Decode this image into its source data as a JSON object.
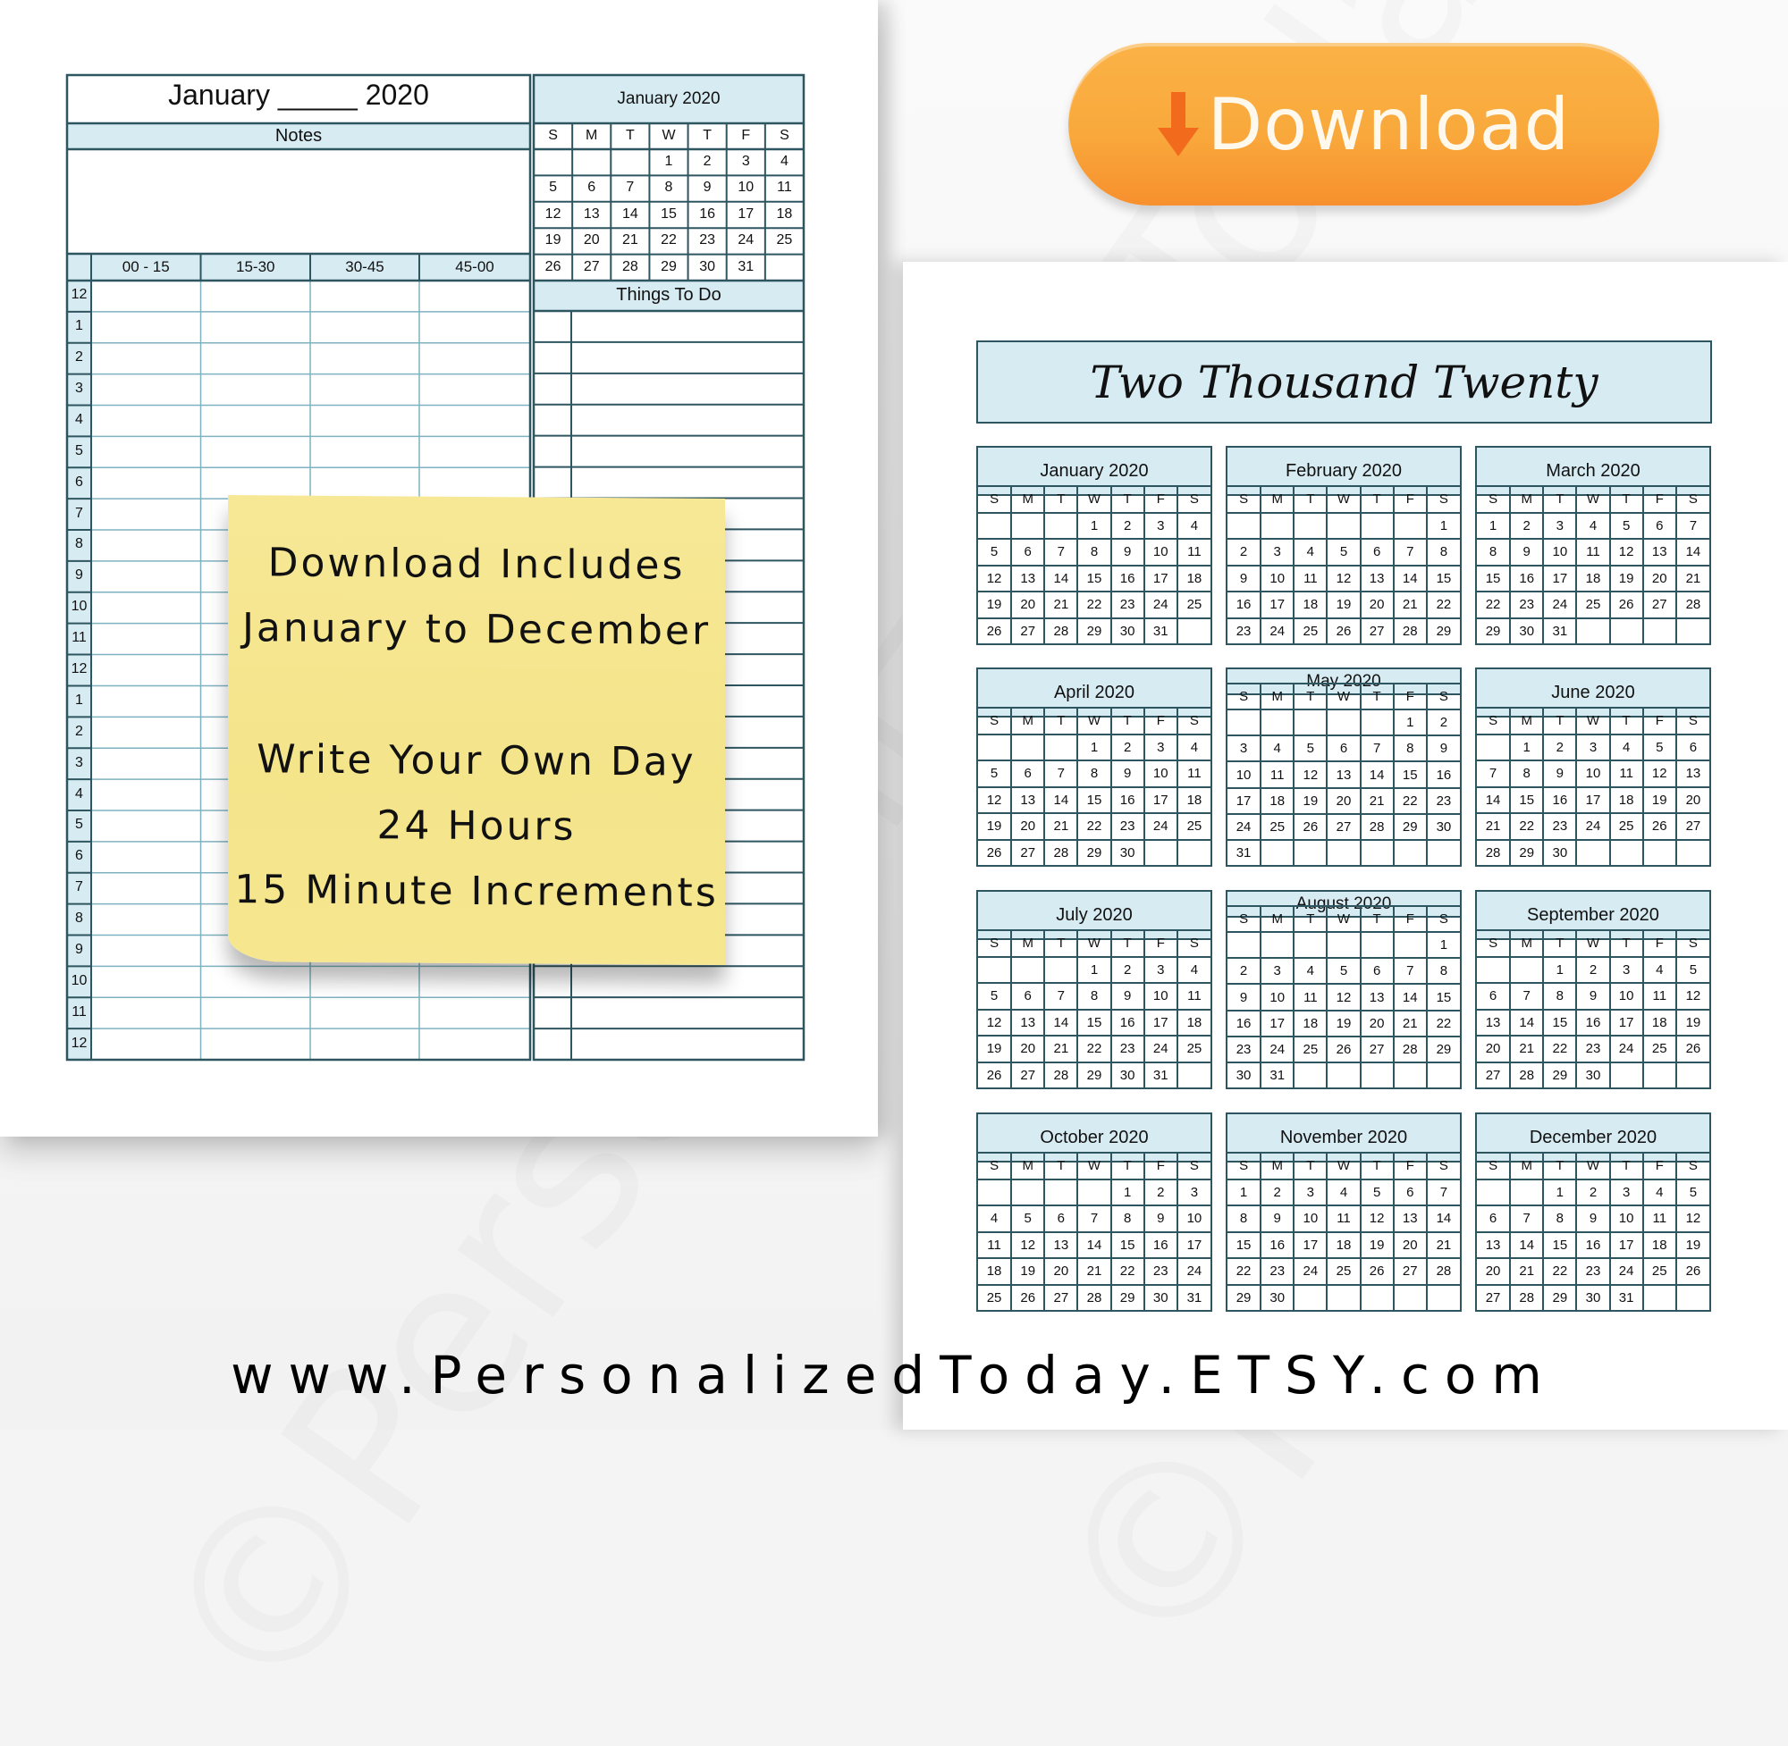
{
  "left_page": {
    "title": "January _____ 2020",
    "notes_label": "Notes",
    "column_headers": [
      "00 - 15",
      "15-30",
      "30-45",
      "45-00"
    ],
    "hours": [
      "12",
      "1",
      "2",
      "3",
      "4",
      "5",
      "6",
      "7",
      "8",
      "9",
      "10",
      "11",
      "12",
      "1",
      "2",
      "3",
      "4",
      "5",
      "6",
      "7",
      "8",
      "9",
      "10",
      "11",
      "12"
    ],
    "mini_calendar": {
      "title": "January 2020",
      "weekdays": [
        "S",
        "M",
        "T",
        "W",
        "T",
        "F",
        "S"
      ],
      "weeks": [
        [
          "",
          "",
          "",
          "1",
          "2",
          "3",
          "4"
        ],
        [
          "5",
          "6",
          "7",
          "8",
          "9",
          "10",
          "11"
        ],
        [
          "12",
          "13",
          "14",
          "15",
          "16",
          "17",
          "18"
        ],
        [
          "19",
          "20",
          "21",
          "22",
          "23",
          "24",
          "25"
        ],
        [
          "26",
          "27",
          "28",
          "29",
          "30",
          "31",
          ""
        ]
      ]
    },
    "todo_label": "Things To Do"
  },
  "sticky_note": {
    "lines": [
      "Download Includes",
      "January to December",
      "",
      "Write Your Own Day",
      "24 Hours",
      "15 Minute Increments"
    ]
  },
  "download_button": {
    "label": "Download",
    "icon": "arrow-down-icon",
    "arrow_color": "#f26b1d",
    "button_color": "#f9a93c"
  },
  "right_page": {
    "title": "Two Thousand Twenty",
    "weekdays": [
      "S",
      "M",
      "T",
      "W",
      "T",
      "F",
      "S"
    ],
    "months": [
      {
        "name": "January 2020",
        "weeks": [
          [
            "",
            "",
            "",
            "1",
            "2",
            "3",
            "4"
          ],
          [
            "5",
            "6",
            "7",
            "8",
            "9",
            "10",
            "11"
          ],
          [
            "12",
            "13",
            "14",
            "15",
            "16",
            "17",
            "18"
          ],
          [
            "19",
            "20",
            "21",
            "22",
            "23",
            "24",
            "25"
          ],
          [
            "26",
            "27",
            "28",
            "29",
            "30",
            "31",
            ""
          ]
        ]
      },
      {
        "name": "February 2020",
        "weeks": [
          [
            "",
            "",
            "",
            "",
            "",
            "",
            "1"
          ],
          [
            "2",
            "3",
            "4",
            "5",
            "6",
            "7",
            "8"
          ],
          [
            "9",
            "10",
            "11",
            "12",
            "13",
            "14",
            "15"
          ],
          [
            "16",
            "17",
            "18",
            "19",
            "20",
            "21",
            "22"
          ],
          [
            "23",
            "24",
            "25",
            "26",
            "27",
            "28",
            "29"
          ]
        ]
      },
      {
        "name": "March 2020",
        "weeks": [
          [
            "1",
            "2",
            "3",
            "4",
            "5",
            "6",
            "7"
          ],
          [
            "8",
            "9",
            "10",
            "11",
            "12",
            "13",
            "14"
          ],
          [
            "15",
            "16",
            "17",
            "18",
            "19",
            "20",
            "21"
          ],
          [
            "22",
            "23",
            "24",
            "25",
            "26",
            "27",
            "28"
          ],
          [
            "29",
            "30",
            "31",
            "",
            "",
            "",
            ""
          ]
        ]
      },
      {
        "name": "April 2020",
        "weeks": [
          [
            "",
            "",
            "",
            "1",
            "2",
            "3",
            "4"
          ],
          [
            "5",
            "6",
            "7",
            "8",
            "9",
            "10",
            "11"
          ],
          [
            "12",
            "13",
            "14",
            "15",
            "16",
            "17",
            "18"
          ],
          [
            "19",
            "20",
            "21",
            "22",
            "23",
            "24",
            "25"
          ],
          [
            "26",
            "27",
            "28",
            "29",
            "30",
            "",
            ""
          ]
        ]
      },
      {
        "name": "May 2020",
        "weeks": [
          [
            "",
            "",
            "",
            "",
            "",
            "1",
            "2"
          ],
          [
            "3",
            "4",
            "5",
            "6",
            "7",
            "8",
            "9"
          ],
          [
            "10",
            "11",
            "12",
            "13",
            "14",
            "15",
            "16"
          ],
          [
            "17",
            "18",
            "19",
            "20",
            "21",
            "22",
            "23"
          ],
          [
            "24",
            "25",
            "26",
            "27",
            "28",
            "29",
            "30"
          ],
          [
            "31",
            "",
            "",
            "",
            "",
            "",
            ""
          ]
        ]
      },
      {
        "name": "June 2020",
        "weeks": [
          [
            "",
            "1",
            "2",
            "3",
            "4",
            "5",
            "6"
          ],
          [
            "7",
            "8",
            "9",
            "10",
            "11",
            "12",
            "13"
          ],
          [
            "14",
            "15",
            "16",
            "17",
            "18",
            "19",
            "20"
          ],
          [
            "21",
            "22",
            "23",
            "24",
            "25",
            "26",
            "27"
          ],
          [
            "28",
            "29",
            "30",
            "",
            "",
            "",
            ""
          ]
        ]
      },
      {
        "name": "July 2020",
        "weeks": [
          [
            "",
            "",
            "",
            "1",
            "2",
            "3",
            "4"
          ],
          [
            "5",
            "6",
            "7",
            "8",
            "9",
            "10",
            "11"
          ],
          [
            "12",
            "13",
            "14",
            "15",
            "16",
            "17",
            "18"
          ],
          [
            "19",
            "20",
            "21",
            "22",
            "23",
            "24",
            "25"
          ],
          [
            "26",
            "27",
            "28",
            "29",
            "30",
            "31",
            ""
          ]
        ]
      },
      {
        "name": "August 2020",
        "weeks": [
          [
            "",
            "",
            "",
            "",
            "",
            "",
            "1"
          ],
          [
            "2",
            "3",
            "4",
            "5",
            "6",
            "7",
            "8"
          ],
          [
            "9",
            "10",
            "11",
            "12",
            "13",
            "14",
            "15"
          ],
          [
            "16",
            "17",
            "18",
            "19",
            "20",
            "21",
            "22"
          ],
          [
            "23",
            "24",
            "25",
            "26",
            "27",
            "28",
            "29"
          ],
          [
            "30",
            "31",
            "",
            "",
            "",
            "",
            ""
          ]
        ]
      },
      {
        "name": "September 2020",
        "weeks": [
          [
            "",
            "",
            "1",
            "2",
            "3",
            "4",
            "5"
          ],
          [
            "6",
            "7",
            "8",
            "9",
            "10",
            "11",
            "12"
          ],
          [
            "13",
            "14",
            "15",
            "16",
            "17",
            "18",
            "19"
          ],
          [
            "20",
            "21",
            "22",
            "23",
            "24",
            "25",
            "26"
          ],
          [
            "27",
            "28",
            "29",
            "30",
            "",
            "",
            ""
          ]
        ]
      },
      {
        "name": "October 2020",
        "weeks": [
          [
            "",
            "",
            "",
            "",
            "1",
            "2",
            "3"
          ],
          [
            "4",
            "5",
            "6",
            "7",
            "8",
            "9",
            "10"
          ],
          [
            "11",
            "12",
            "13",
            "14",
            "15",
            "16",
            "17"
          ],
          [
            "18",
            "19",
            "20",
            "21",
            "22",
            "23",
            "24"
          ],
          [
            "25",
            "26",
            "27",
            "28",
            "29",
            "30",
            "31"
          ]
        ]
      },
      {
        "name": "November 2020",
        "weeks": [
          [
            "1",
            "2",
            "3",
            "4",
            "5",
            "6",
            "7"
          ],
          [
            "8",
            "9",
            "10",
            "11",
            "12",
            "13",
            "14"
          ],
          [
            "15",
            "16",
            "17",
            "18",
            "19",
            "20",
            "21"
          ],
          [
            "22",
            "23",
            "24",
            "25",
            "26",
            "27",
            "28"
          ],
          [
            "29",
            "30",
            "",
            "",
            "",
            "",
            ""
          ]
        ]
      },
      {
        "name": "December 2020",
        "weeks": [
          [
            "",
            "",
            "1",
            "2",
            "3",
            "4",
            "5"
          ],
          [
            "6",
            "7",
            "8",
            "9",
            "10",
            "11",
            "12"
          ],
          [
            "13",
            "14",
            "15",
            "16",
            "17",
            "18",
            "19"
          ],
          [
            "20",
            "21",
            "22",
            "23",
            "24",
            "25",
            "26"
          ],
          [
            "27",
            "28",
            "29",
            "30",
            "31",
            "",
            ""
          ]
        ]
      }
    ]
  },
  "footer": {
    "url": "www.PersonalizedToday.ETSY.com"
  },
  "watermark": {
    "text": "©Personalized Today"
  },
  "colors": {
    "accent_light_blue": "#d7ebf2",
    "grid_line": "#2e5660",
    "sticky_yellow": "#f4e48a"
  }
}
